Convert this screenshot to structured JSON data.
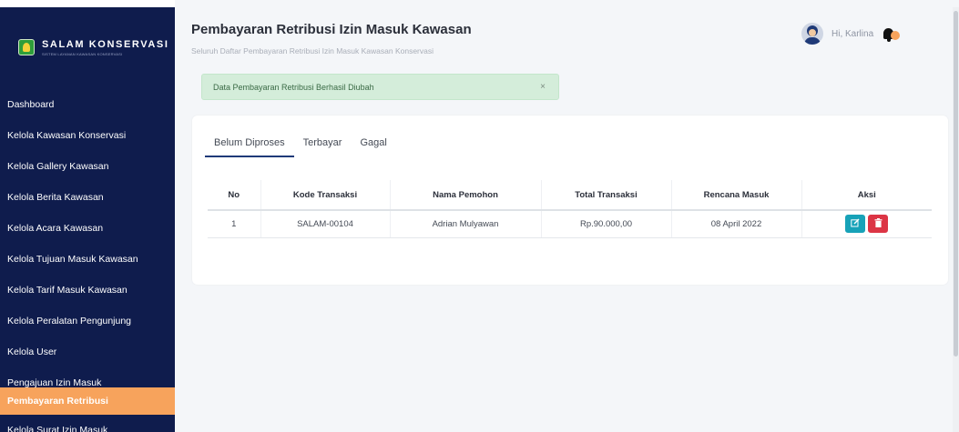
{
  "brand": {
    "name": "SALAM KONSERVASI",
    "tagline": "SISTEM LAYANAN KAWASAN KONSERVASI"
  },
  "sidebar": {
    "items": [
      {
        "label": "Dashboard",
        "active": false
      },
      {
        "label": "Kelola Kawasan Konservasi",
        "active": false
      },
      {
        "label": "Kelola Gallery Kawasan",
        "active": false
      },
      {
        "label": "Kelola Berita Kawasan",
        "active": false
      },
      {
        "label": "Kelola Acara Kawasan",
        "active": false
      },
      {
        "label": "Kelola Tujuan Masuk Kawasan",
        "active": false
      },
      {
        "label": "Kelola Tarif Masuk Kawasan",
        "active": false
      },
      {
        "label": "Kelola Peralatan Pengunjung",
        "active": false
      },
      {
        "label": "Kelola User",
        "active": false
      },
      {
        "label": "Pengajuan Izin Masuk",
        "active": false
      },
      {
        "label": "Pembayaran Retribusi",
        "active": true
      },
      {
        "label": "Kelola Surat Izin Masuk",
        "active": false
      }
    ]
  },
  "header": {
    "title": "Pembayaran Retribusi Izin Masuk Kawasan",
    "subtitle": "Seluruh Daftar Pembayaran Retribusi Izin Masuk Kawasan Konservasi",
    "greeting": "Hi, Karlina"
  },
  "alert": {
    "message": "Data Pembayaran Retribusi Berhasil Diubah",
    "close": "×"
  },
  "tabs": [
    {
      "label": "Belum Diproses",
      "active": true
    },
    {
      "label": "Terbayar",
      "active": false
    },
    {
      "label": "Gagal",
      "active": false
    }
  ],
  "table": {
    "headers": [
      "No",
      "Kode Transaksi",
      "Nama Pemohon",
      "Total Transaksi",
      "Rencana Masuk",
      "Aksi"
    ],
    "rows": [
      {
        "no": "1",
        "kode": "SALAM-00104",
        "nama": "Adrian Mulyawan",
        "total": "Rp.90.000,00",
        "rencana": "08 April 2022"
      }
    ]
  },
  "colors": {
    "sidebar": "#0f1c4d",
    "active": "#f7a35c",
    "edit": "#17a2b8",
    "delete": "#dc3545"
  }
}
